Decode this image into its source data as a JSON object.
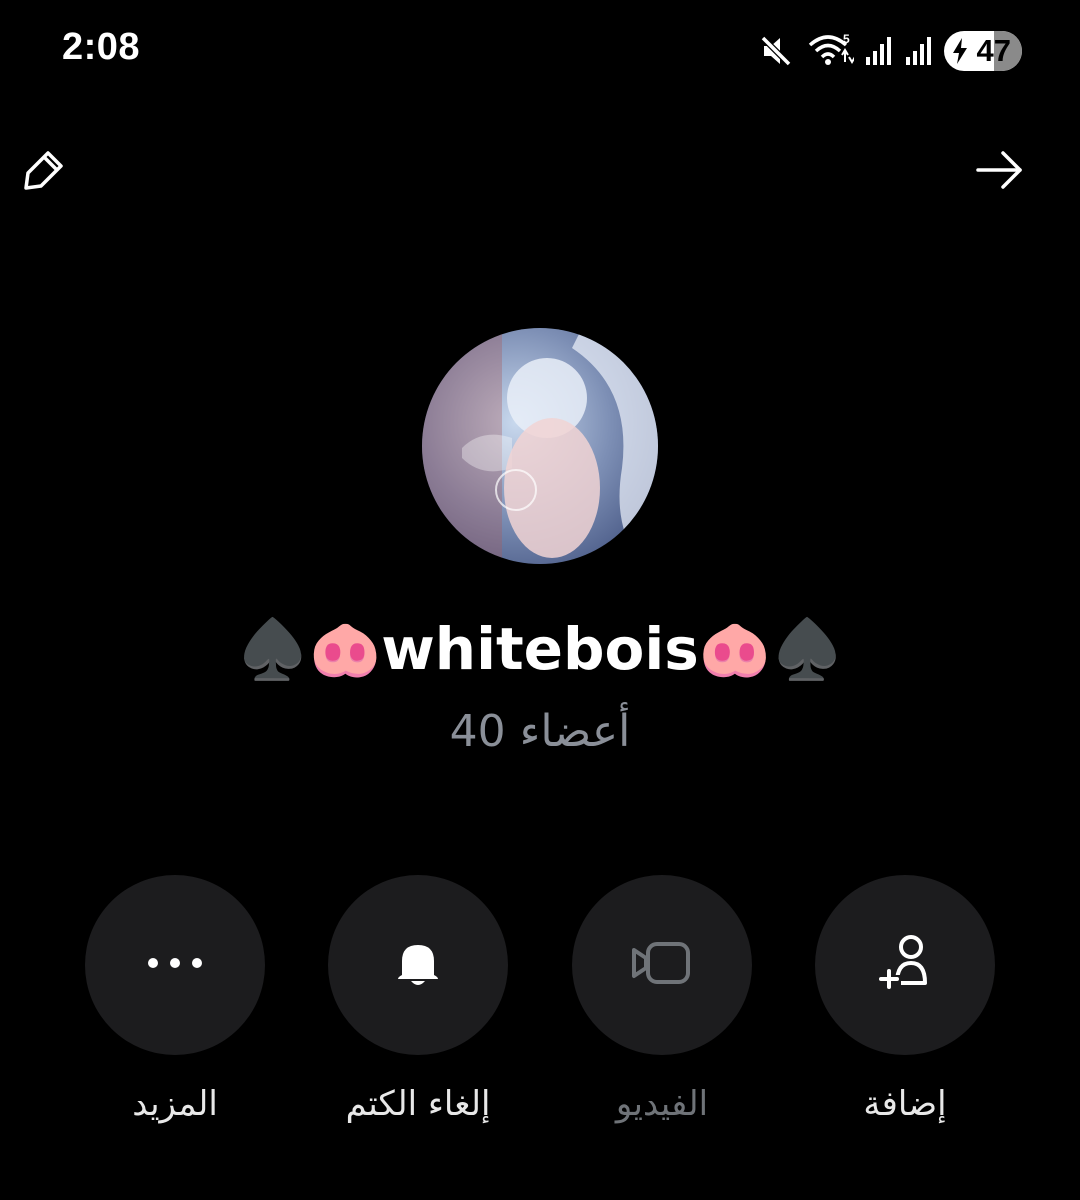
{
  "status_bar": {
    "time": "2:08",
    "battery_level": "47",
    "icons": [
      "mute-icon",
      "wifi-icon",
      "signal-icon",
      "signal-icon",
      "battery-charging-icon"
    ]
  },
  "header": {
    "left_icon": "pencil-icon",
    "right_icon": "arrow-right-icon"
  },
  "profile": {
    "avatar": "group-avatar-image",
    "name": "♠️🐽whitebois🐽♠️",
    "members": "40 أعضاء"
  },
  "actions": [
    {
      "label": "المزيد",
      "icon": "more-dots-icon",
      "enabled": true
    },
    {
      "label": "إلغاء الكتم",
      "icon": "bell-icon",
      "enabled": true
    },
    {
      "label": "الفيديو",
      "icon": "video-camera-icon",
      "enabled": false
    },
    {
      "label": "إضافة",
      "icon": "add-person-icon",
      "enabled": true
    }
  ],
  "colors": {
    "background": "#000000",
    "button_background": "#1c1c1e",
    "secondary_text": "#8a8f98",
    "disabled_text": "#6f7378"
  }
}
